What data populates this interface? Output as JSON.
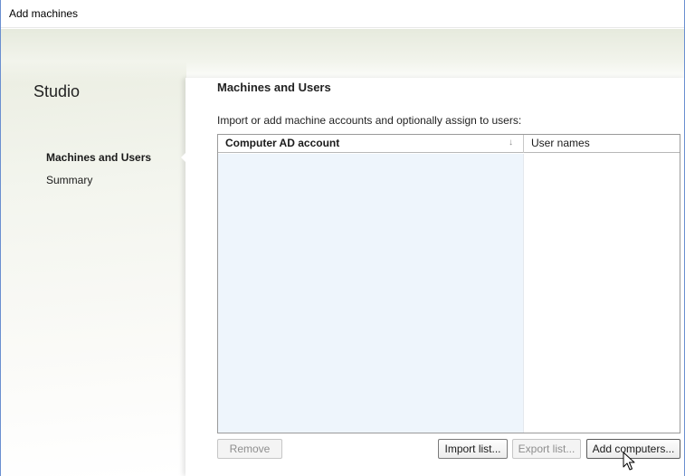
{
  "window": {
    "title": "Add machines"
  },
  "sidebar": {
    "app_name": "Studio",
    "items": [
      {
        "label": "Machines and Users",
        "active": true
      },
      {
        "label": "Summary",
        "active": false
      }
    ]
  },
  "main": {
    "title": "Machines and Users",
    "instruction": "Import or add machine accounts and optionally assign to users:",
    "table": {
      "columns": [
        {
          "label": "Computer AD account",
          "sort_icon": "sort-down-arrow-icon"
        },
        {
          "label": "User names"
        }
      ],
      "rows": []
    },
    "buttons": {
      "remove": {
        "label": "Remove",
        "enabled": false
      },
      "import": {
        "label": "Import list...",
        "enabled": true
      },
      "export": {
        "label": "Export list...",
        "enabled": false
      },
      "add": {
        "label": "Add computers...",
        "enabled": true
      }
    }
  },
  "colors": {
    "ad_column_bg": "#eef5fc",
    "window_border": "#6a8fd0"
  }
}
